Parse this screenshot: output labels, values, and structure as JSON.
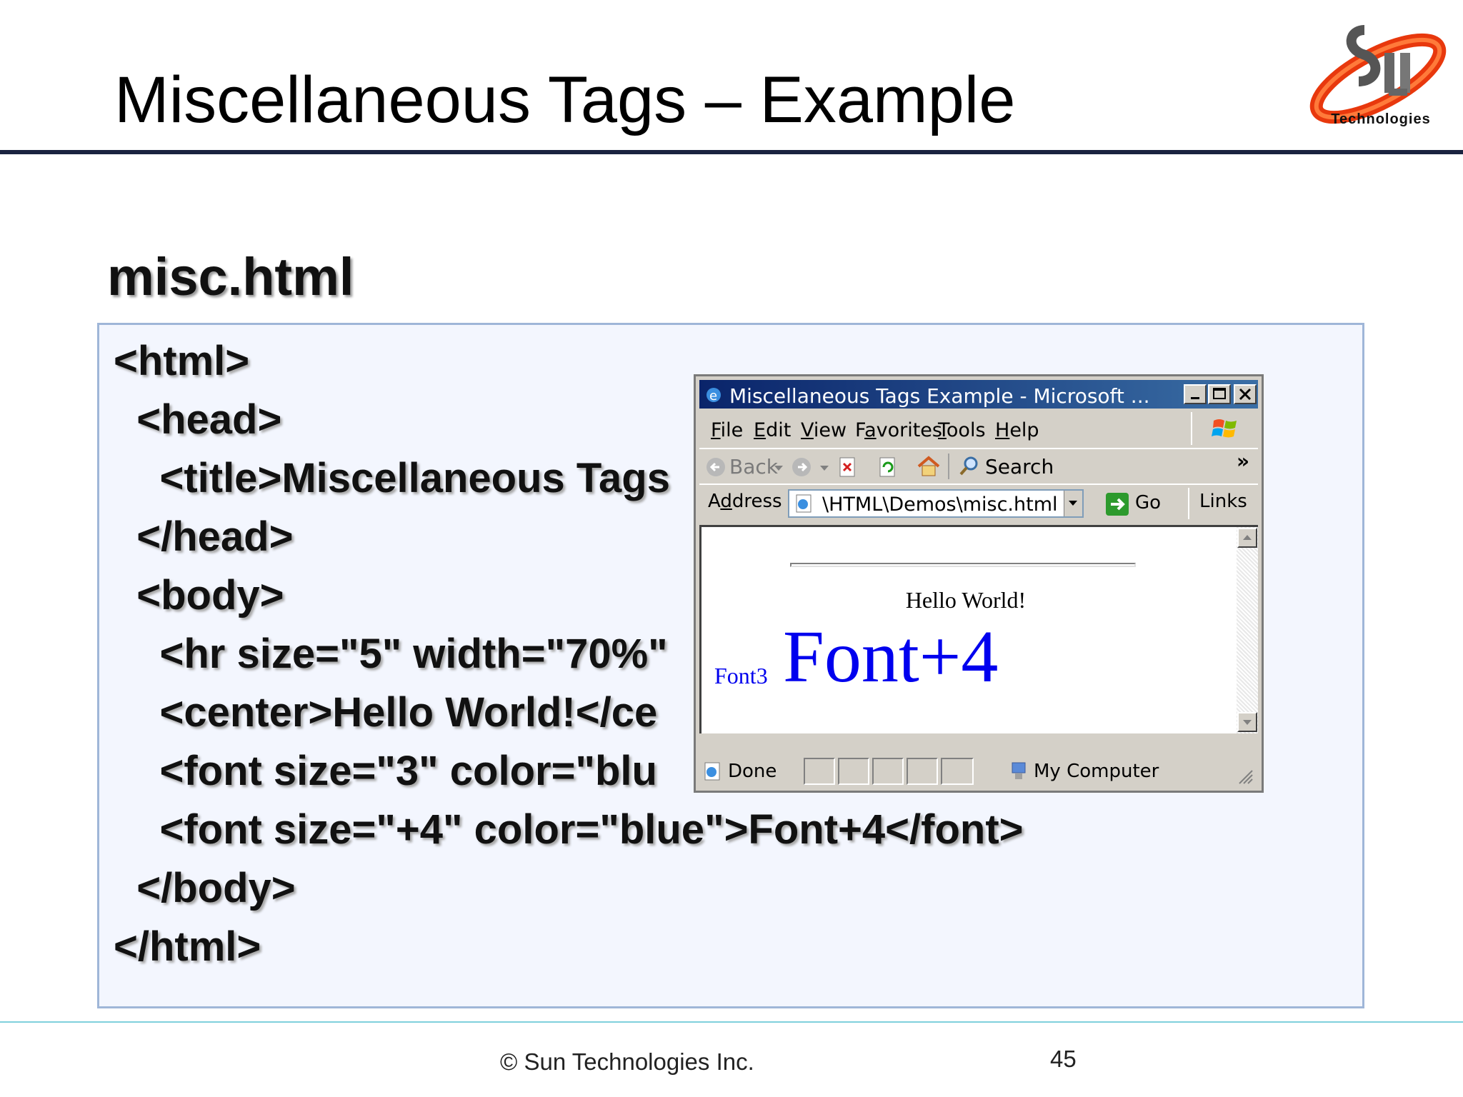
{
  "slide": {
    "title": "Miscellaneous Tags – Example",
    "subtitle": "misc.html",
    "logo_caption": "Technologies",
    "code_lines": [
      "<html>",
      "  <head>",
      "    <title>Miscellaneous Tags",
      "  </head>",
      "  <body>",
      "    <hr size=\"5\" width=\"70%\"",
      "    <center>Hello World!</ce",
      "    <font size=\"3\" color=\"blu",
      "    <font size=\"+4\" color=\"blue\">Font+4</font>",
      "  </body>",
      "</html>"
    ],
    "footer": {
      "copyright": "© Sun Technologies Inc.",
      "page": "45"
    }
  },
  "browser": {
    "title": "Miscellaneous Tags Example - Microsoft ...",
    "menu": [
      {
        "key": "F",
        "rest": "ile"
      },
      {
        "key": "E",
        "rest": "dit"
      },
      {
        "key": "V",
        "rest": "iew"
      },
      {
        "pre": "F",
        "key": "a",
        "rest": "vorites"
      },
      {
        "key": "T",
        "rest": "ools"
      },
      {
        "key": "H",
        "rest": "elp"
      }
    ],
    "toolbar": {
      "back": "Back",
      "search": "Search",
      "more": "»"
    },
    "address": {
      "label_pre": "A",
      "label_key": "d",
      "label_rest": "dress",
      "value": "\\HTML\\Demos\\misc.html",
      "go": "Go",
      "links": "Links"
    },
    "page": {
      "hello": "Hello World!",
      "font3": "Font3",
      "font4": "Font+4"
    },
    "status": {
      "left": "Done",
      "zone": "My Computer"
    },
    "colors": {
      "title_bar": "#0a246a",
      "link_blue": "#0000ee",
      "chrome": "#d4d0c8"
    }
  }
}
